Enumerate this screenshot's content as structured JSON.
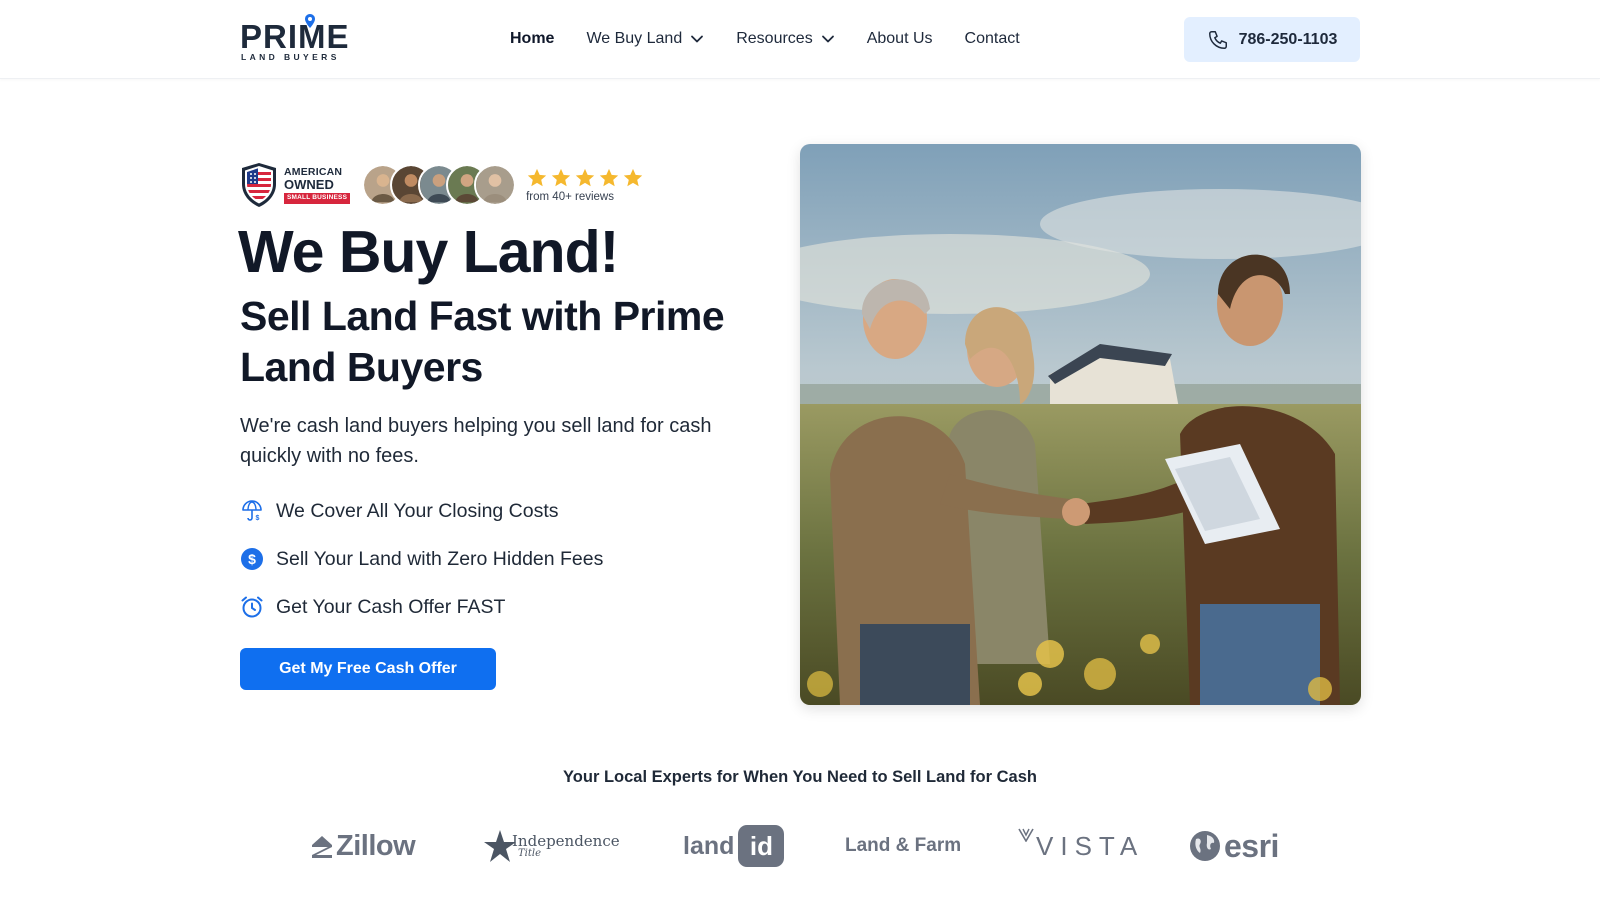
{
  "brand": {
    "logo_main": "PRIME",
    "logo_sub": "LAND BUYERS",
    "logo_icon": "map-pin-icon"
  },
  "nav": {
    "items": [
      {
        "label": "Home",
        "active": true,
        "has_dropdown": false
      },
      {
        "label": "We Buy Land",
        "active": false,
        "has_dropdown": true
      },
      {
        "label": "Resources",
        "active": false,
        "has_dropdown": true
      },
      {
        "label": "About Us",
        "active": false,
        "has_dropdown": false
      },
      {
        "label": "Contact",
        "active": false,
        "has_dropdown": false
      }
    ],
    "phone": "786-250-1103",
    "phone_icon": "phone-icon"
  },
  "hero": {
    "badge": {
      "line1": "AMERICAN",
      "line2": "OWNED",
      "line3": "SMALL BUSINESS"
    },
    "rating": {
      "stars": 5,
      "reviews_text": "from 40+ reviews"
    },
    "title": "We Buy Land!",
    "subtitle": "Sell Land Fast with Prime Land Buyers",
    "description": "We're cash land buyers helping you sell land for cash quickly with no fees.",
    "features": [
      {
        "icon": "umbrella-dollar-icon",
        "text": "We Cover All Your Closing Costs"
      },
      {
        "icon": "dollar-circle-icon",
        "text": "Sell Your Land with Zero Hidden Fees"
      },
      {
        "icon": "alarm-clock-icon",
        "text": "Get Your Cash Offer FAST"
      }
    ],
    "cta_label": "Get My Free Cash Offer"
  },
  "partners": {
    "title": "Your Local Experts for When You Need to Sell Land for Cash",
    "logos": [
      {
        "name": "Zillow",
        "text": "Zillow"
      },
      {
        "name": "Independence Title",
        "text": "Independence",
        "script": "Title"
      },
      {
        "name": "land id",
        "text": "land",
        "box": "id"
      },
      {
        "name": "Land & Farm",
        "text": "Land & Farm"
      },
      {
        "name": "Vista",
        "text": "VISTA"
      },
      {
        "name": "Esri",
        "text": "esri"
      }
    ]
  },
  "colors": {
    "primary": "#0f6ff0",
    "phone_bg": "#e3efff",
    "heading": "#111827",
    "star": "#f5b82e",
    "partner_gray": "#6b7280"
  }
}
